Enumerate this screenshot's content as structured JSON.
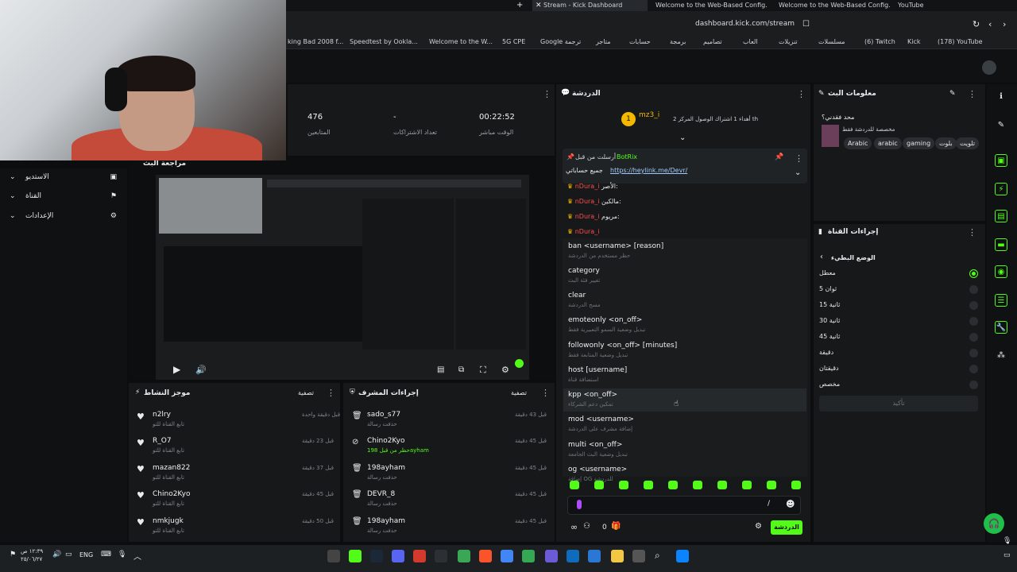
{
  "browser": {
    "tabs": [
      {
        "label": "YouTube"
      },
      {
        "label": "Welcome to the Web-Based Config..."
      },
      {
        "label": "Welcome to the Web-Based Config..."
      },
      {
        "label": "Stream - Kick Dashboard"
      }
    ],
    "url": "dashboard.kick.com/stream",
    "bookmarks": [
      "(178) YouTube",
      "Kick",
      "(6) Twitch",
      "مسلسلات",
      "تنزيلات",
      "العاب",
      "تصاميم",
      "برمجة",
      "حسابات",
      "متاجر",
      "Google ترجمة",
      "5G CPE",
      "Welcome to the W...",
      "Speedtest by Ookla...",
      "king Bad 2008 f..."
    ]
  },
  "nav": {
    "items": [
      "الاستديو",
      "القناة",
      "الإعدادات"
    ],
    "preview_title": "مراجعة البث"
  },
  "stats": {
    "live_time_value": "00:22:52",
    "live_time_label": "الوقت مباشر",
    "subs_value": "-",
    "subs_label": "تعداد الاشتراكات",
    "followers_value": "476",
    "followers_label": "المتابعين"
  },
  "chat": {
    "title": "الدردشة",
    "top_user": "mz3_i",
    "top_badge": "1",
    "gift_text": "أهداء 1 اشتراك الوصول المركز 2 th",
    "pinned_by": "أرسلت من قبل",
    "pinned_user": "BotRix",
    "pinned_text": "جميع حساباتي",
    "pinned_link": "https://heylink.me/Devr/",
    "messages": [
      {
        "user": "nDura_i",
        "text": "الأصر:"
      },
      {
        "user": "nDura_i",
        "text": "مالكين:"
      },
      {
        "user": "nDura_i",
        "text": "مريوم:"
      },
      {
        "user": "nDura_i",
        "text": ""
      }
    ],
    "commands": [
      {
        "cmd": "ban <username> [reason]",
        "desc": "حظر مستخدم من الدردشة"
      },
      {
        "cmd": "category",
        "desc": "تغيير فئة البث"
      },
      {
        "cmd": "clear",
        "desc": "مسح الدردشة"
      },
      {
        "cmd": "emoteonly <on_off>",
        "desc": "تبديل وضعية السمو التعبيرية فقط"
      },
      {
        "cmd": "followonly <on_off> [minutes]",
        "desc": "تبديل وضعية المتابعة فقط"
      },
      {
        "cmd": "host [username]",
        "desc": "استضافة قناة"
      },
      {
        "cmd": "kpp <on_off>",
        "desc": "تمكين دعم الشركاء"
      },
      {
        "cmd": "mod <username>",
        "desc": "إضافة مشرف على الدردشة"
      },
      {
        "cmd": "multi <on_off>",
        "desc": "تبديل وضعية البث الجامعة"
      },
      {
        "cmd": "og <username>",
        "desc": "إضافة OG للدردشة"
      }
    ],
    "input_value": "/",
    "points": "0",
    "send_label": "الدردشة"
  },
  "info": {
    "title": "معلومات البث",
    "stream_title": "محد فقدني؟",
    "subtitle": "مخصصة للدردشة فقط",
    "tags": [
      "Arabic",
      "arabic",
      "gaming",
      "بلوت",
      "تلويت"
    ]
  },
  "actions": {
    "title": "إجراءات القناة",
    "slow_mode": "الوضع البطيء",
    "modes": [
      "معطل",
      "ثوان 5",
      "ثانية 15",
      "ثانية 30",
      "ثانية 45",
      "دقيقة",
      "دقيقتان",
      "مخصص"
    ],
    "confirm": "تأكيد"
  },
  "activity": {
    "title": "موجز النشاط",
    "filter": "تصفية",
    "rows": [
      {
        "name": "n2lry",
        "sub": "تابع القناة للتو",
        "time": "قبل دقيقة واحدة"
      },
      {
        "name": "R_O7",
        "sub": "تابع القناة للتو",
        "time": "قبل 23 دقيقة"
      },
      {
        "name": "mazan822",
        "sub": "تابع القناة للتو",
        "time": "قبل 37 دقيقة"
      },
      {
        "name": "Chino2Kyo",
        "sub": "تابع القناة للتو",
        "time": "قبل 45 دقيقة"
      },
      {
        "name": "nmkjugk",
        "sub": "تابع القناة للتو",
        "time": "قبل 50 دقيقة"
      }
    ]
  },
  "modactions": {
    "title": "إجراءات المشرف",
    "filter": "تصفية",
    "rows": [
      {
        "name": "sado_s77",
        "sub": "حذفت رسالة",
        "time": "قبل 43 دقيقة"
      },
      {
        "name": "Chino2Kyo",
        "sub": "حظر من قبل 198ayham",
        "time": "قبل 45 دقيقة"
      },
      {
        "name": "198ayham",
        "sub": "حذفت رسالة",
        "time": "قبل 45 دقيقة"
      },
      {
        "name": "DEVR_8",
        "sub": "حذفت رسالة",
        "time": "قبل 45 دقيقة"
      },
      {
        "name": "198ayham",
        "sub": "حذفت رسالة",
        "time": "قبل 45 دقيقة"
      }
    ]
  },
  "taskbar": {
    "time": "١٢:٣٩ ص",
    "date": "٢٥/٠٦/٢٧",
    "lang": "ENG"
  },
  "colors": {
    "accent": "#53fc18",
    "panel": "#16181a",
    "bg": "#0b0d0e"
  }
}
